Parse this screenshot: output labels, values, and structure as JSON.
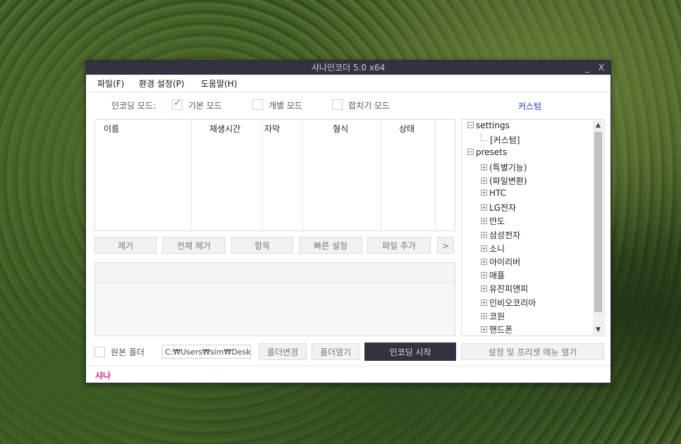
{
  "window": {
    "title": "샤나인코더  5.0  x64",
    "minimize": "_",
    "close": "X"
  },
  "menu": [
    "파일(F)",
    "환경 설정(P)",
    "도움말(H)"
  ],
  "encoding_mode": {
    "label": "인코딩 모드:",
    "options": [
      {
        "label": "기본 모드",
        "checked": true
      },
      {
        "label": "개별 모드",
        "checked": false
      },
      {
        "label": "합치기 모드",
        "checked": false
      }
    ]
  },
  "custom_link": "커스텀",
  "file_list": {
    "columns": [
      "이름",
      "재생시간",
      "자막",
      "형식",
      "상태"
    ],
    "rows": []
  },
  "actions": {
    "remove": "제거",
    "remove_all": "전체 제거",
    "item": "항목",
    "quick_settings": "빠른 설정",
    "add_file": "파일 추가",
    "more": ">"
  },
  "tree": {
    "nodes": [
      {
        "label": "settings",
        "level": 0,
        "toggle": "−"
      },
      {
        "label": "[커스텀]",
        "level": 1,
        "toggle": ""
      },
      {
        "label": "presets",
        "level": 0,
        "toggle": "−"
      },
      {
        "label": "(특별기능)",
        "level": 1,
        "toggle": "+"
      },
      {
        "label": "(파일변환)",
        "level": 1,
        "toggle": "+"
      },
      {
        "label": "HTC",
        "level": 1,
        "toggle": "+"
      },
      {
        "label": "LG전자",
        "level": 1,
        "toggle": "+"
      },
      {
        "label": "만도",
        "level": 1,
        "toggle": "+"
      },
      {
        "label": "삼성전자",
        "level": 1,
        "toggle": "+"
      },
      {
        "label": "소니",
        "level": 1,
        "toggle": "+"
      },
      {
        "label": "아이리버",
        "level": 1,
        "toggle": "+"
      },
      {
        "label": "애플",
        "level": 1,
        "toggle": "+"
      },
      {
        "label": "유진피앤피",
        "level": 1,
        "toggle": "+"
      },
      {
        "label": "인비오코리아",
        "level": 1,
        "toggle": "+"
      },
      {
        "label": "코원",
        "level": 1,
        "toggle": "+"
      },
      {
        "label": "핸드폰",
        "level": 1,
        "toggle": "+"
      }
    ],
    "scroll_up": "▲",
    "scroll_down": "▼"
  },
  "bottom": {
    "source_folder_label": "원본 폴더",
    "source_folder_checked": false,
    "path_value": "C:₩Users₩sim₩Desk",
    "change_folder": "폴더변경",
    "open_folder": "폴더열기",
    "start_encoding": "인코딩 시작",
    "open_menu": "설정 및 프리셋 메뉴 열기"
  },
  "status": "샤나",
  "colors": {
    "titlebar": "#333340",
    "accent_pink": "#e05e91",
    "link_blue": "#1b34b8",
    "status_pink": "#d0308a"
  }
}
